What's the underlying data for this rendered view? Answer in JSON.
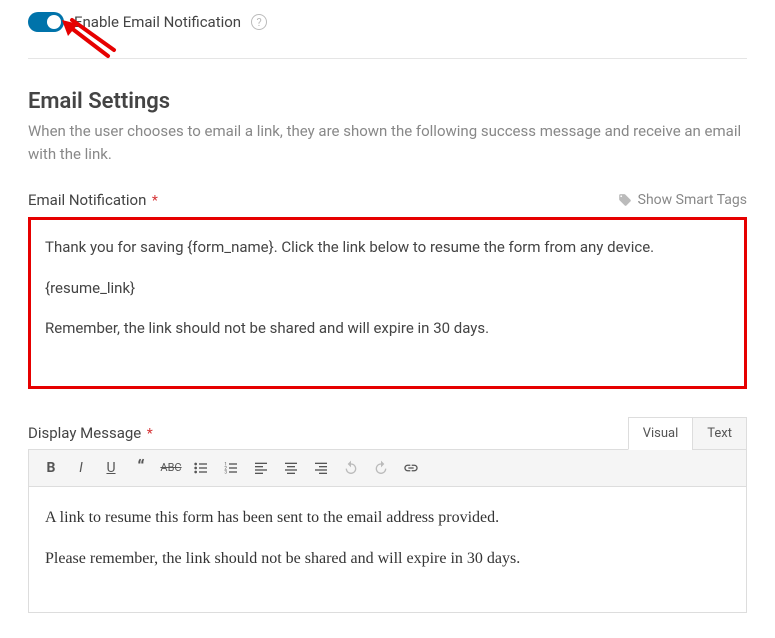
{
  "toggle": {
    "label": "Enable Email Notification",
    "enabled": true
  },
  "section": {
    "title": "Email Settings",
    "description": "When the user chooses to email a link, they are shown the following success message and receive an email with the link."
  },
  "emailNotif": {
    "label": "Email Notification",
    "smartTagsLabel": "Show Smart Tags",
    "line1": "Thank you for saving {form_name}. Click the link below to resume the form from any device.",
    "line2": "{resume_link}",
    "line3": "Remember, the link should not be shared and will expire in 30 days."
  },
  "displayMsg": {
    "label": "Display Message",
    "tabs": {
      "visual": "Visual",
      "text": "Text"
    },
    "content": {
      "line1": "A link to resume this form has been sent to the email address provided.",
      "line2": "Please remember, the link should not be shared and will expire in 30 days."
    }
  }
}
